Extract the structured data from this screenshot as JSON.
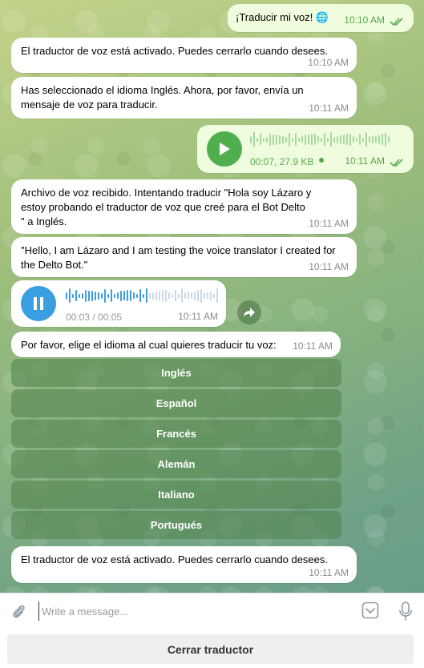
{
  "messages": {
    "m1": {
      "text": "¡Traducir mi voz! 🌐",
      "time": "10:10 AM"
    },
    "m2": {
      "text": "El traductor de voz está activado. Puedes cerrarlo cuando desees.",
      "time": "10:10 AM"
    },
    "m3": {
      "text": "Has seleccionado el idioma Inglés. Ahora, por favor, envía un mensaje de voz para traducir.",
      "time": "10:11 AM"
    },
    "m4": {
      "meta": "00:07, 27.9 KB",
      "time": "10:11 AM"
    },
    "m5": {
      "text": "Archivo de voz recibido. Intentando traducir \"Hola soy Lázaro y estoy probando el traductor de voz que creé para el Bot Delto\n\" a Inglés.",
      "time": "10:11 AM"
    },
    "m6": {
      "text": "\"Hello, I am Lázaro and I am testing the voice translator I created for the Delto Bot.\"",
      "time": "10:11 AM"
    },
    "m7": {
      "meta": "00:03 / 00:05",
      "time": "10:11 AM"
    },
    "m8": {
      "text": "Por favor, elige el idioma al cual quieres traducir tu voz:",
      "time": "10:11 AM"
    },
    "m9": {
      "text": "El traductor de voz está activado. Puedes cerrarlo cuando desees.",
      "time": "10:11 AM"
    }
  },
  "keyboard": [
    "Inglés",
    "Español",
    "Francés",
    "Alemán",
    "Italiano",
    "Portugués"
  ],
  "composer": {
    "placeholder": "Write a message..."
  },
  "bottom": {
    "close_label": "Cerrar traductor"
  },
  "colors": {
    "accent": "#4fae4e",
    "voice_blue": "#3a9fe0",
    "outgoing_bg": "#effdde"
  },
  "icons": [
    "globe-icon",
    "double-check-icon",
    "play-icon",
    "pause-icon",
    "share-icon",
    "attach-icon",
    "keyboard-icon",
    "microphone-icon"
  ]
}
